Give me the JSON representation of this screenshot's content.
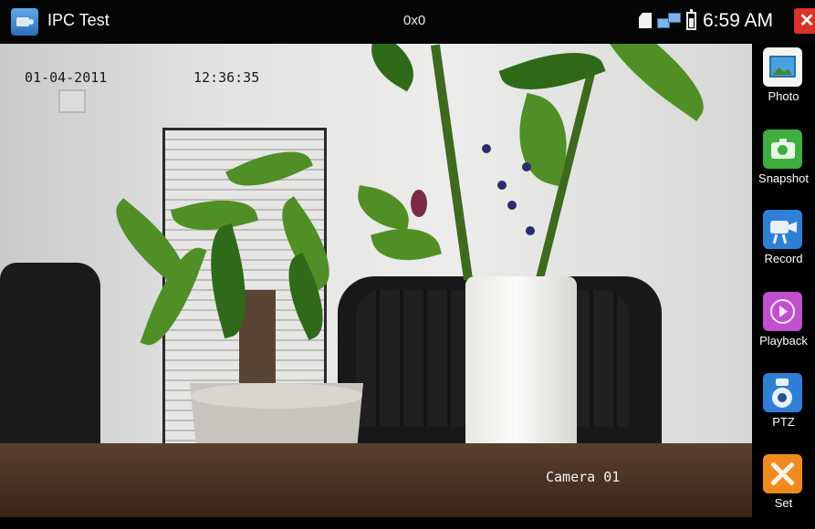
{
  "statusbar": {
    "app_title": "IPC Test",
    "resolution": "0x0",
    "time": "6:59 AM",
    "close_symbol": "✕"
  },
  "video": {
    "osd_date": "01-04-2011",
    "osd_time": "12:36:35",
    "camera_name": "Camera 01"
  },
  "menu": {
    "items": [
      {
        "label": "Photo",
        "icon": "photo-icon",
        "color": "#ffffff"
      },
      {
        "label": "Snapshot",
        "icon": "camera-icon",
        "color": "#3fae3f"
      },
      {
        "label": "Record",
        "icon": "video-camera-icon",
        "color": "#2f7fd6"
      },
      {
        "label": "Playback",
        "icon": "play-icon",
        "color": "#c24fd0"
      },
      {
        "label": "PTZ",
        "icon": "ptz-dome-icon",
        "color": "#2f7fd6"
      },
      {
        "label": "Set",
        "icon": "tools-icon",
        "color": "#f08a1e"
      }
    ]
  }
}
